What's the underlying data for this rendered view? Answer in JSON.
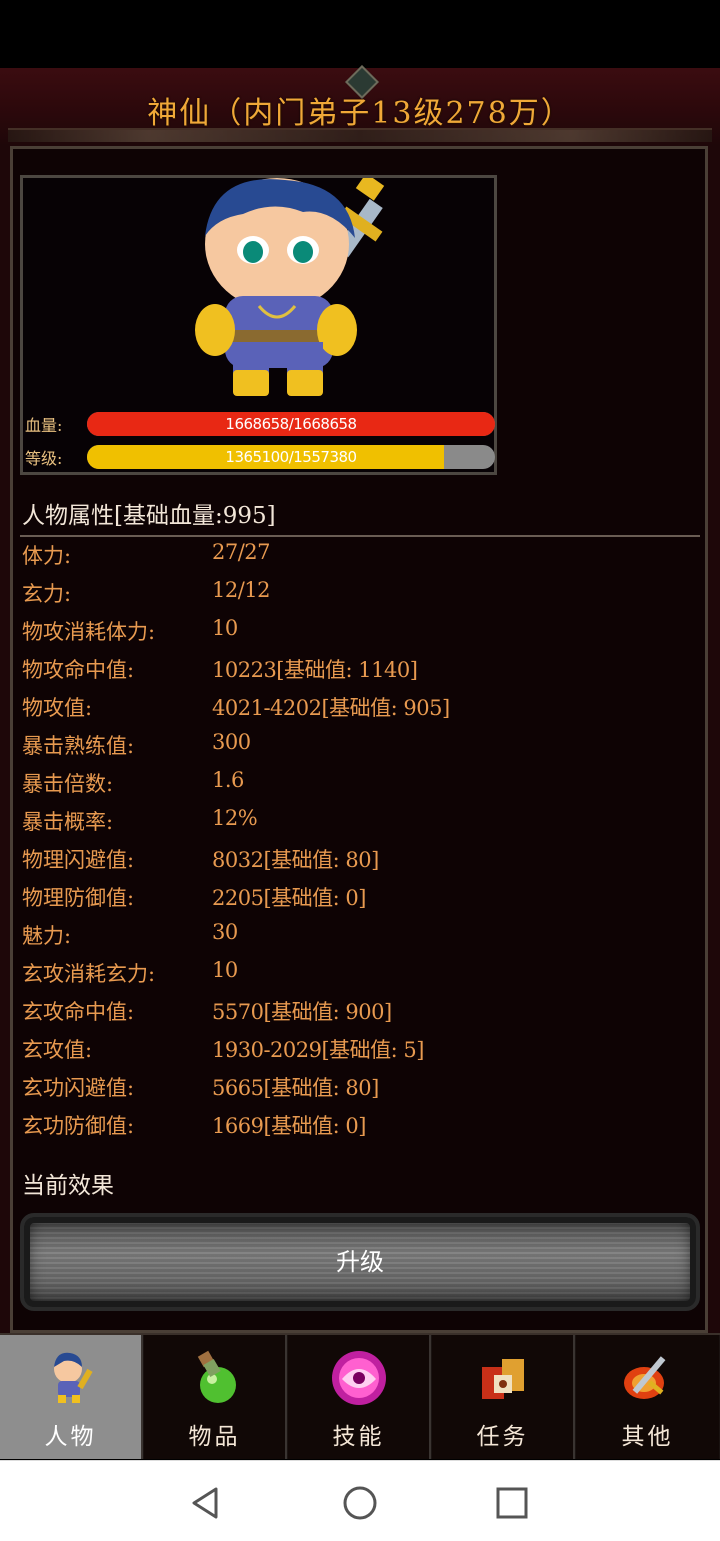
{
  "title": "神仙（内门弟子13级278万）",
  "stats": {
    "hp_label": "血量:",
    "hp_value": "1668658/1668658",
    "hp_ratio": 1.0,
    "level_label": "等级:",
    "level_value": "1365100/1557380",
    "level_ratio": 0.876
  },
  "attributes": {
    "header": "人物属性[基础血量:995]",
    "rows": [
      {
        "key": "体力:",
        "value": "27/27"
      },
      {
        "key": "玄力:",
        "value": "12/12"
      },
      {
        "key": "物攻消耗体力:",
        "value": "10"
      },
      {
        "key": "物攻命中值:",
        "value": "10223[基础值: 1140]"
      },
      {
        "key": "物攻值:",
        "value": "4021-4202[基础值: 905]"
      },
      {
        "key": "暴击熟练值:",
        "value": "300"
      },
      {
        "key": "暴击倍数:",
        "value": "1.6"
      },
      {
        "key": "暴击概率:",
        "value": "12%"
      },
      {
        "key": "物理闪避值:",
        "value": "8032[基础值: 80]"
      },
      {
        "key": "物理防御值:",
        "value": "2205[基础值: 0]"
      },
      {
        "key": "魅力:",
        "value": "30"
      },
      {
        "key": "玄攻消耗玄力:",
        "value": "10"
      },
      {
        "key": "玄攻命中值:",
        "value": "5570[基础值: 900]"
      },
      {
        "key": "玄攻值:",
        "value": "1930-2029[基础值: 5]"
      },
      {
        "key": "玄功闪避值:",
        "value": "5665[基础值: 80]"
      },
      {
        "key": "玄功防御值:",
        "value": "1669[基础值: 0]"
      }
    ]
  },
  "effects_label": "当前效果",
  "upgrade_label": "升级",
  "tabs": [
    {
      "label": "人物",
      "icon": "character-icon",
      "active": true
    },
    {
      "label": "物品",
      "icon": "potion-icon",
      "active": false
    },
    {
      "label": "技能",
      "icon": "skill-orb-icon",
      "active": false
    },
    {
      "label": "任务",
      "icon": "quest-icon",
      "active": false
    },
    {
      "label": "其他",
      "icon": "sword-shield-icon",
      "active": false
    }
  ],
  "nav": [
    "back-icon",
    "home-icon",
    "recents-icon"
  ],
  "colors": {
    "title": "#f0a838",
    "hp": "#e82814",
    "level": "#f0c000",
    "attr": "#e89a50"
  }
}
